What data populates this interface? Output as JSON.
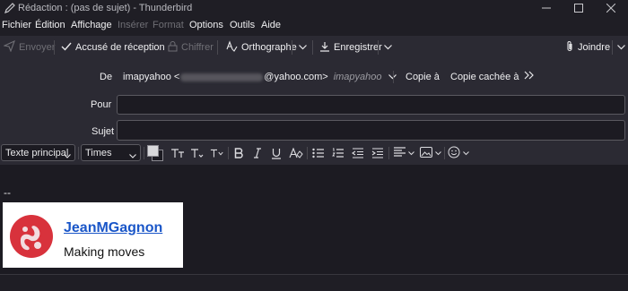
{
  "window": {
    "title": "Rédaction : (pas de sujet) - Thunderbird"
  },
  "menu": {
    "items": [
      {
        "label": "Fichier",
        "enabled": true
      },
      {
        "label": "Édition",
        "enabled": true
      },
      {
        "label": "Affichage",
        "enabled": true
      },
      {
        "label": "Insérer",
        "enabled": false
      },
      {
        "label": "Format",
        "enabled": false
      },
      {
        "label": "Options",
        "enabled": true
      },
      {
        "label": "Outils",
        "enabled": true
      },
      {
        "label": "Aide",
        "enabled": true
      }
    ]
  },
  "toolbar": {
    "send_label": "Envoyer",
    "receipt_label": "Accusé de réception",
    "encrypt_label": "Chiffrer",
    "spelling_label": "Orthographe",
    "save_label": "Enregistrer",
    "attach_label": "Joindre"
  },
  "header": {
    "from_label": "De",
    "from_name": "imapyahoo <",
    "from_domain": "@yahoo.com>",
    "from_account": "imapyahoo",
    "cc_label": "Copie à",
    "bcc_label": "Copie cachée à",
    "to_label": "Pour",
    "to_value": "",
    "subject_label": "Sujet",
    "subject_value": ""
  },
  "format": {
    "paragraph_style": "Texte principal",
    "font": "Times"
  },
  "body": {
    "signature_dash": "--",
    "signature_name": "JeanMGagnon",
    "signature_tagline": "Making moves"
  },
  "colors": {
    "accent": "#1a56c8",
    "logo": "#d8323c"
  }
}
